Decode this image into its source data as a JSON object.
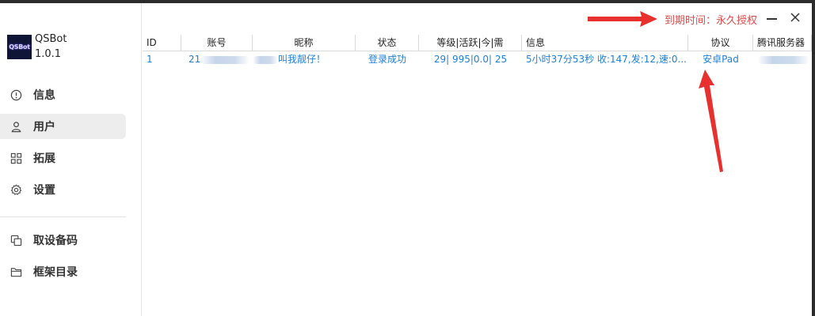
{
  "app": {
    "name": "QSBot",
    "version": "1.0.1",
    "logo_text": "QSBot"
  },
  "sidebar": {
    "items": [
      {
        "label": "信息",
        "icon": "info-icon"
      },
      {
        "label": "用户",
        "icon": "user-icon",
        "active": true
      },
      {
        "label": "拓展",
        "icon": "grid-icon"
      },
      {
        "label": "设置",
        "icon": "gear-icon"
      }
    ],
    "items2": [
      {
        "label": "取设备码",
        "icon": "copy-icon"
      },
      {
        "label": "框架目录",
        "icon": "folder-icon"
      }
    ]
  },
  "titlebar": {
    "expire_text": "到期时间：永久授权"
  },
  "table": {
    "headers": [
      "ID",
      "账号",
      "昵称",
      "状态",
      "等级|活跃|今|需",
      "信息",
      "协议",
      "腾讯服务器"
    ],
    "rows": [
      {
        "id": "1",
        "account": "21",
        "nickname": "叫我靓仔！",
        "status": "登录成功",
        "level": "29| 995|0.0| 25",
        "info": "5小时37分53秒 收:147,发:12,速:0...",
        "protocol": "安卓Pad",
        "server": ""
      }
    ]
  },
  "colors": {
    "accent_link": "#1e7fd8",
    "expire_red": "#e04b4b",
    "annotation_arrow": "#e8302e",
    "active_nav_bg": "#ededed"
  }
}
